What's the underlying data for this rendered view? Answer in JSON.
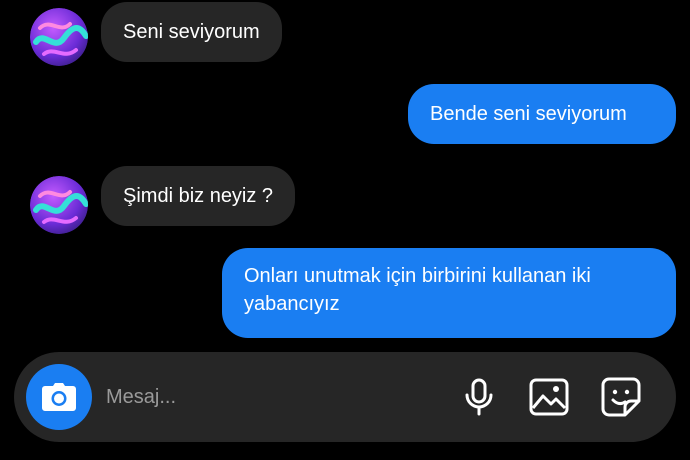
{
  "messages": [
    {
      "direction": "incoming",
      "text": "Seni seviyorum"
    },
    {
      "direction": "outgoing",
      "text": "Bende seni seviyorum"
    },
    {
      "direction": "incoming",
      "text": "Şimdi biz neyiz ?"
    },
    {
      "direction": "outgoing",
      "text": "Onları unutmak için birbirini kullanan iki yabancıyız"
    }
  ],
  "composer": {
    "placeholder": "Mesaj...",
    "icons": [
      "camera-icon",
      "microphone-icon",
      "image-icon",
      "sticker-icon"
    ]
  },
  "colors": {
    "background": "#000000",
    "incoming_bubble": "#262626",
    "outgoing_bubble": "#1a7ef2",
    "accent": "#1a7ef2",
    "placeholder_text": "#9a9a9a"
  }
}
